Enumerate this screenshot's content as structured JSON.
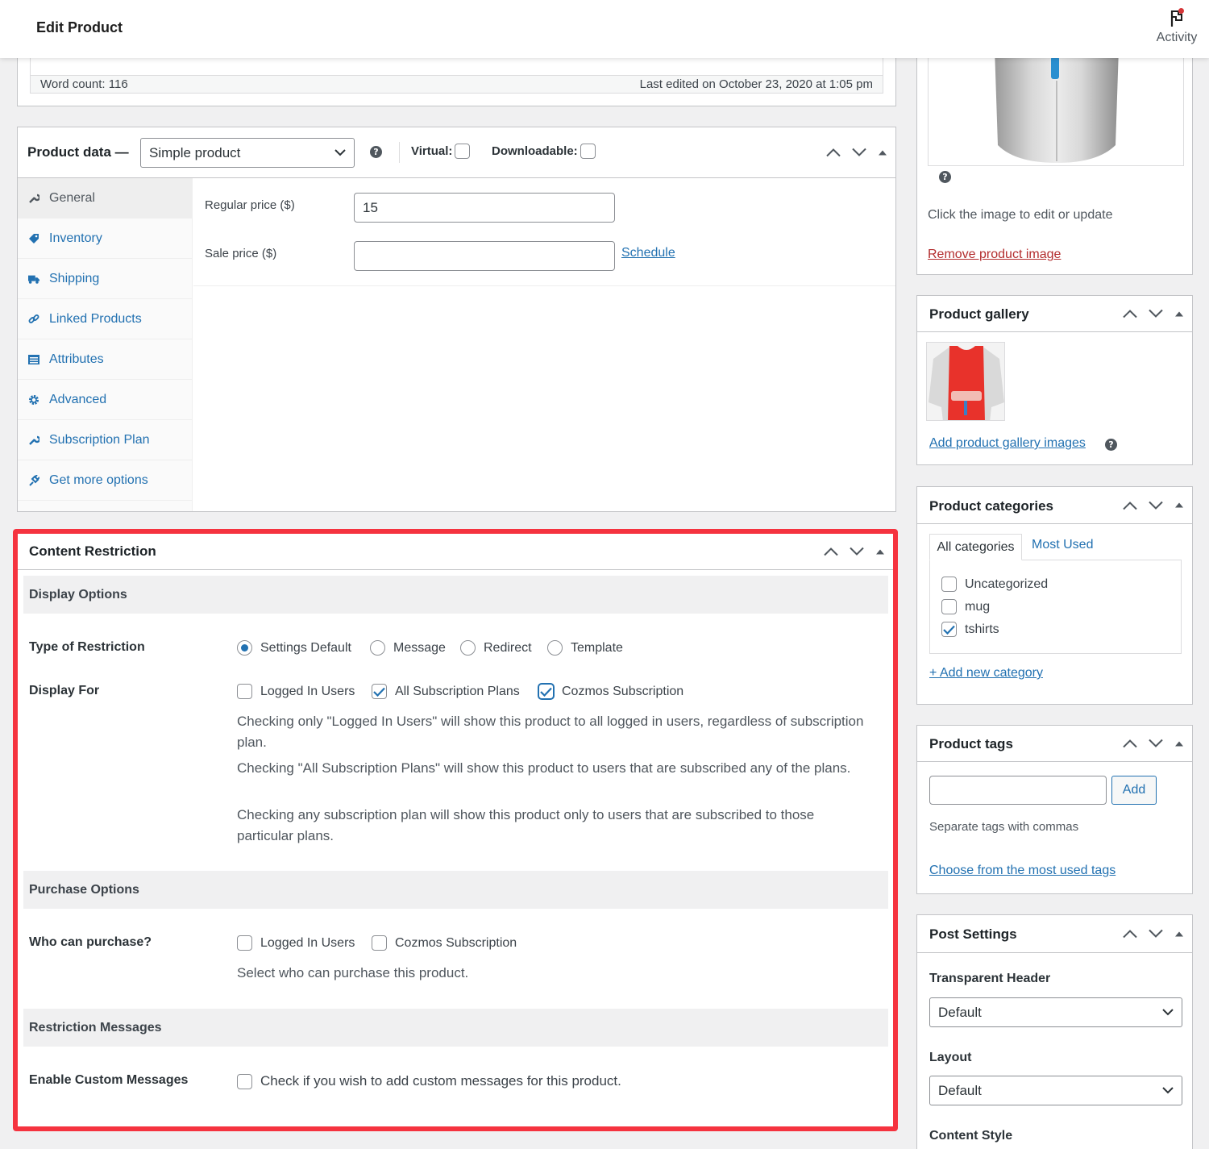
{
  "header": {
    "title": "Edit Product",
    "activity_label": "Activity"
  },
  "editor": {
    "word_count": "Word count: 116",
    "last_edited": "Last edited on October 23, 2020 at 1:05 pm"
  },
  "product_data": {
    "title": "Product data —",
    "type_select": "Simple product",
    "virtual_label": "Virtual:",
    "downloadable_label": "Downloadable:",
    "tabs": [
      {
        "label": "General",
        "icon": "wrench-icon"
      },
      {
        "label": "Inventory",
        "icon": "tag-icon"
      },
      {
        "label": "Shipping",
        "icon": "truck-icon"
      },
      {
        "label": "Linked Products",
        "icon": "link-icon"
      },
      {
        "label": "Attributes",
        "icon": "list-icon"
      },
      {
        "label": "Advanced",
        "icon": "gear-icon"
      },
      {
        "label": "Subscription Plan",
        "icon": "wrench-icon"
      },
      {
        "label": "Get more options",
        "icon": "plugin-icon"
      }
    ],
    "regular_price_label": "Regular price ($)",
    "regular_price_value": "15",
    "sale_price_label": "Sale price ($)",
    "sale_price_value": "",
    "schedule_link": "Schedule"
  },
  "content_restriction": {
    "title": "Content Restriction",
    "display_options_heading": "Display Options",
    "type_label": "Type of Restriction",
    "type_options": [
      "Settings Default",
      "Message",
      "Redirect",
      "Template"
    ],
    "type_selected": "Settings Default",
    "display_for_label": "Display For",
    "display_for_options": [
      "Logged In Users",
      "All Subscription Plans",
      "Cozmos Subscription"
    ],
    "display_for_checked": [
      false,
      true,
      true
    ],
    "desc_1": "Checking only \"Logged In Users\" will show this product to all logged in users, regardless of subscription plan.",
    "desc_2": "Checking \"All Subscription Plans\" will show this product to users that are subscribed any of the plans.",
    "desc_3": "Checking any subscription plan will show this product only to users that are subscribed to those particular plans.",
    "purchase_heading": "Purchase Options",
    "who_label": "Who can purchase?",
    "who_options": [
      "Logged In Users",
      "Cozmos Subscription"
    ],
    "who_desc": "Select who can purchase this product.",
    "messages_heading": "Restriction Messages",
    "custom_label": "Enable Custom Messages",
    "custom_desc": "Check if you wish to add custom messages for this product."
  },
  "sidebar": {
    "image_hint": "Click the image to edit or update",
    "remove_image": "Remove product image",
    "gallery_title": "Product gallery",
    "add_gallery": "Add product gallery images",
    "categories_title": "Product categories",
    "cat_tab_all": "All categories",
    "cat_tab_most": "Most Used",
    "categories": [
      {
        "name": "Uncategorized",
        "checked": false
      },
      {
        "name": "mug",
        "checked": false
      },
      {
        "name": "tshirts",
        "checked": true
      }
    ],
    "add_category": "+ Add new category",
    "tags_title": "Product tags",
    "tags_input": "",
    "tags_add": "Add",
    "tags_hint": "Separate tags with commas",
    "tags_choose": "Choose from the most used tags",
    "post_settings_title": "Post Settings",
    "transparent_header_label": "Transparent Header",
    "transparent_header_value": "Default",
    "layout_label": "Layout",
    "layout_value": "Default",
    "content_style_label": "Content Style"
  },
  "colors": {
    "link": "#2271b1",
    "highlight": "#f5333f",
    "remove_link": "#b32d2e"
  }
}
